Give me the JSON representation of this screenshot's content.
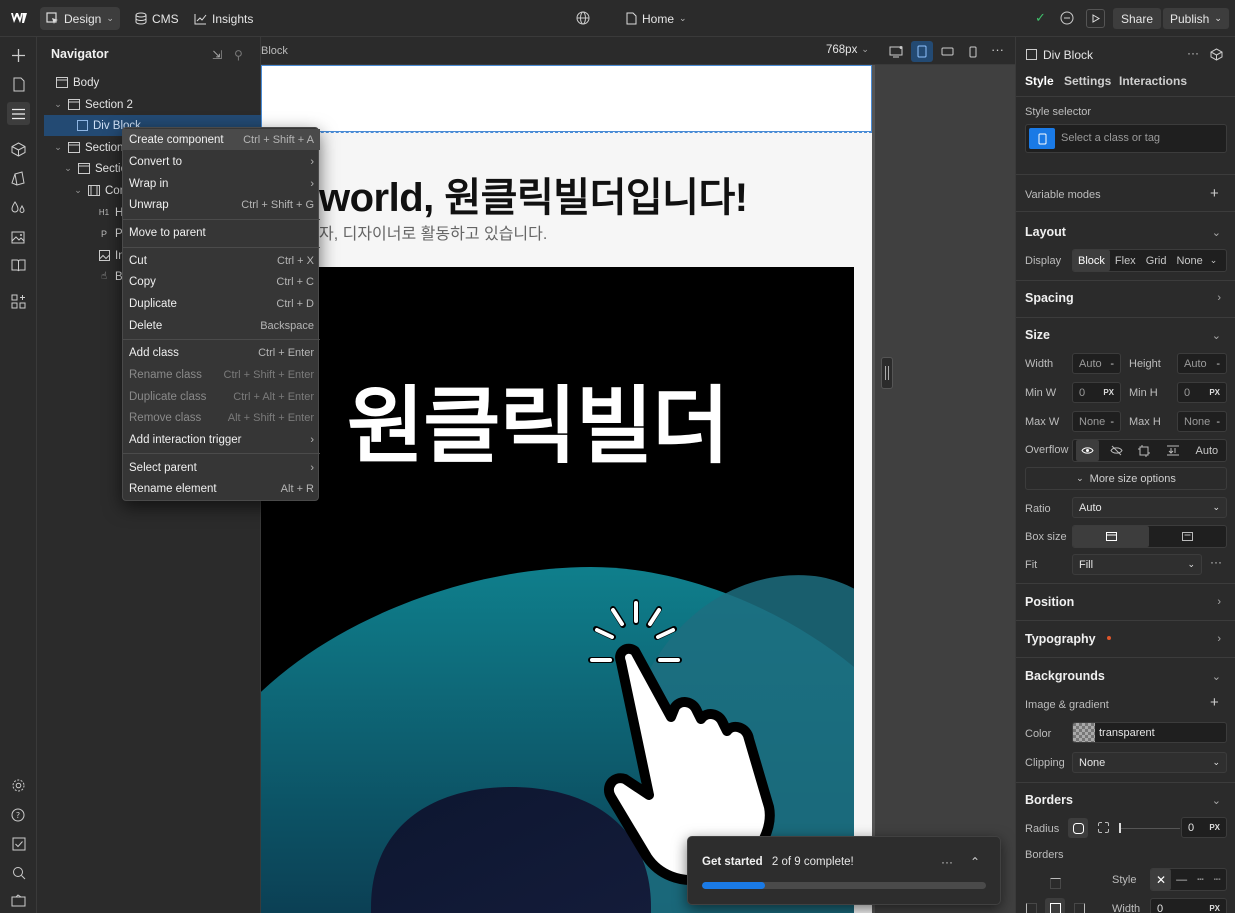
{
  "topbar": {
    "design_label": "Design",
    "cms_label": "CMS",
    "insights_label": "Insights",
    "page_label": "Home",
    "share_label": "Share",
    "publish_label": "Publish"
  },
  "navigator": {
    "title": "Navigator",
    "items": [
      {
        "label": "Body"
      },
      {
        "label": "Section 2"
      },
      {
        "label": "Div Block"
      },
      {
        "label": "Section"
      },
      {
        "label": "Sectio"
      },
      {
        "label": "Con"
      },
      {
        "label": "He"
      },
      {
        "label": "Pa"
      },
      {
        "label": "Im"
      },
      {
        "label": "Bu"
      }
    ]
  },
  "context_menu": {
    "items": [
      {
        "label": "Create component",
        "shortcut": "Ctrl + Shift + A"
      },
      {
        "label": "Convert to",
        "shortcut": "›"
      },
      {
        "label": "Wrap in",
        "shortcut": "›"
      },
      {
        "label": "Unwrap",
        "shortcut": "Ctrl + Shift + G"
      },
      {
        "label": "Move to parent",
        "shortcut": ""
      },
      {
        "label": "Cut",
        "shortcut": "Ctrl + X"
      },
      {
        "label": "Copy",
        "shortcut": "Ctrl + C"
      },
      {
        "label": "Duplicate",
        "shortcut": "Ctrl + D"
      },
      {
        "label": "Delete",
        "shortcut": "Backspace"
      },
      {
        "label": "Add class",
        "shortcut": "Ctrl + Enter"
      },
      {
        "label": "Rename class",
        "shortcut": "Ctrl + Shift + Enter"
      },
      {
        "label": "Duplicate class",
        "shortcut": "Ctrl + Alt + Enter"
      },
      {
        "label": "Remove class",
        "shortcut": "Alt + Shift + Enter"
      },
      {
        "label": "Add interaction trigger",
        "shortcut": "›"
      },
      {
        "label": "Select parent",
        "shortcut": "›"
      },
      {
        "label": "Rename element",
        "shortcut": "Alt + R"
      }
    ]
  },
  "canvas": {
    "breadcrumb": "Block",
    "width_label": "768px",
    "heading": "world, 원클릭빌더입니다!",
    "subtext": "자, 디자이너로 활동하고 있습니다.",
    "hero_title": "원클릭빌더"
  },
  "toast": {
    "title": "Get started",
    "progress_text": "2 of 9 complete!",
    "completed": 2,
    "total": 9
  },
  "rightpanel": {
    "element_name": "Div Block",
    "tabs": [
      "Style",
      "Settings",
      "Interactions"
    ],
    "style_selector_label": "Style selector",
    "style_selector_placeholder": "Select a class or tag",
    "variable_modes": "Variable modes",
    "layout": {
      "title": "Layout",
      "display_label": "Display",
      "display_options": [
        "Block",
        "Flex",
        "Grid",
        "None"
      ]
    },
    "spacing_title": "Spacing",
    "size": {
      "title": "Size",
      "width_label": "Width",
      "width_value": "Auto",
      "height_label": "Height",
      "height_value": "Auto",
      "minw_label": "Min W",
      "minw_value": "0",
      "minh_label": "Min H",
      "minh_value": "0",
      "maxw_label": "Max W",
      "maxw_value": "None",
      "maxh_label": "Max H",
      "maxh_value": "None",
      "unit": "PX",
      "dash": "-",
      "overflow_label": "Overflow",
      "overflow_auto": "Auto",
      "more_options": "More size options",
      "ratio_label": "Ratio",
      "ratio_value": "Auto",
      "boxsize_label": "Box size",
      "fit_label": "Fit",
      "fit_value": "Fill"
    },
    "position_title": "Position",
    "typography_title": "Typography",
    "backgrounds": {
      "title": "Backgrounds",
      "image_gradient": "Image & gradient",
      "color_label": "Color",
      "color_value": "transparent",
      "clipping_label": "Clipping",
      "clipping_value": "None"
    },
    "borders": {
      "title": "Borders",
      "radius_label": "Radius",
      "radius_value": "0",
      "borders_label": "Borders",
      "style_label": "Style",
      "width_label": "Width",
      "width_value": "0"
    }
  },
  "colors": {
    "accent": "#1a7ae6",
    "selection": "#234a73",
    "check_green": "#3fbf6a",
    "typography_dot": "#e0562a"
  }
}
